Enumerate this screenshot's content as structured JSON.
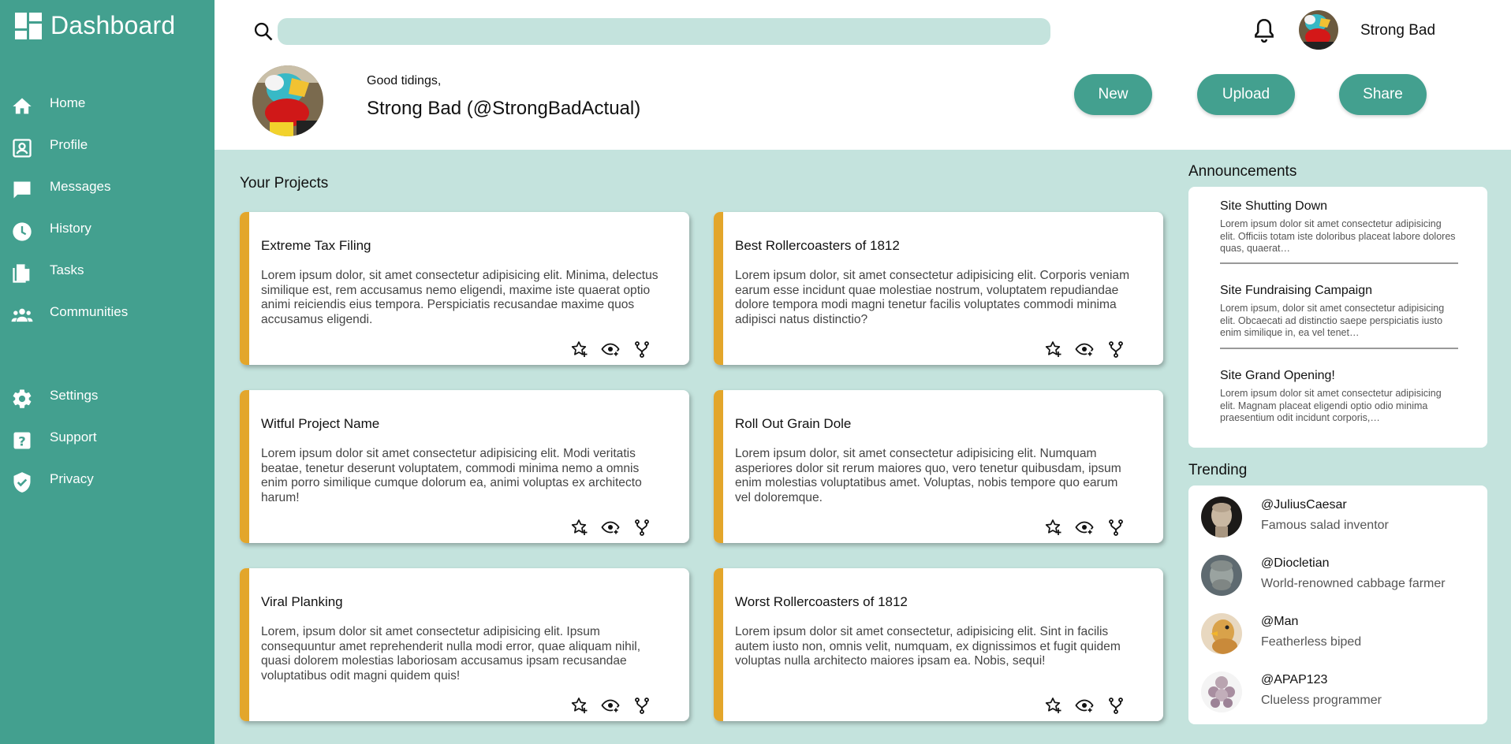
{
  "sidebar": {
    "title": "Dashboard",
    "nav": [
      {
        "label": "Home",
        "icon": "home-icon"
      },
      {
        "label": "Profile",
        "icon": "profile-card-icon"
      },
      {
        "label": "Messages",
        "icon": "chat-bubble-icon"
      },
      {
        "label": "History",
        "icon": "clock-icon"
      },
      {
        "label": "Tasks",
        "icon": "documents-icon"
      },
      {
        "label": "Communities",
        "icon": "people-icon"
      },
      {
        "label": "Settings",
        "icon": "gear-icon"
      },
      {
        "label": "Support",
        "icon": "help-icon"
      },
      {
        "label": "Privacy",
        "icon": "shield-check-icon"
      }
    ]
  },
  "header": {
    "search": {
      "value": "",
      "placeholder": ""
    },
    "username": "Strong Bad",
    "greeting": "Good tidings,",
    "handle": "Strong Bad (@StrongBadActual)",
    "buttons": {
      "new": "New",
      "upload": "Upload",
      "share": "Share"
    }
  },
  "projects": {
    "title": "Your Projects",
    "items": [
      {
        "title": "Extreme Tax Filing",
        "body": "Lorem ipsum dolor, sit amet consectetur adipisicing elit. Minima, delectus similique est, rem accusamus nemo eligendi, maxime iste quaerat optio animi reiciendis eius tempora. Perspiciatis recusandae maxime quos accusamus eligendi."
      },
      {
        "title": "Best Rollercoasters of 1812",
        "body": "Lorem ipsum dolor, sit amet consectetur adipisicing elit. Corporis veniam earum esse incidunt quae molestiae nostrum, voluptatem repudiandae dolore tempora modi magni tenetur facilis voluptates commodi minima adipisci natus distinctio?"
      },
      {
        "title": "Witful Project Name",
        "body": "Lorem ipsum dolor sit amet consectetur adipisicing elit. Modi veritatis beatae, tenetur deserunt voluptatem, commodi minima nemo a omnis enim porro similique cumque dolorum ea, animi voluptas ex architecto harum!"
      },
      {
        "title": "Roll Out Grain Dole",
        "body": "Lorem ipsum dolor, sit amet consectetur adipisicing elit. Numquam asperiores dolor sit rerum maiores quo, vero tenetur quibusdam, ipsum enim molestias voluptatibus amet. Voluptas, nobis tempore quo earum vel doloremque."
      },
      {
        "title": "Viral Planking",
        "body": "Lorem, ipsum dolor sit amet consectetur adipisicing elit. Ipsum consequuntur amet reprehenderit nulla modi error, quae aliquam nihil, quasi dolorem molestias laboriosam accusamus ipsam recusandae voluptatibus odit magni quidem quis!"
      },
      {
        "title": "Worst Rollercoasters of 1812",
        "body": "Lorem ipsum dolor sit amet consectetur, adipisicing elit. Sint in facilis autem iusto non, omnis velit, numquam, ex dignissimos et fugit quidem voluptas nulla architecto maiores ipsam ea. Nobis, sequi!"
      }
    ],
    "action_icons": [
      "star-add-icon",
      "eye-add-icon",
      "fork-icon"
    ]
  },
  "announcements": {
    "title": "Announcements",
    "items": [
      {
        "title": "Site Shutting Down",
        "text": "Lorem ipsum dolor sit amet consectetur adipisicing elit. Officiis totam iste doloribus placeat labore dolores quas, quaerat…"
      },
      {
        "title": "Site Fundraising Campaign",
        "text": "Lorem ipsum, dolor sit amet consectetur adipisicing elit. Obcaecati ad distinctio saepe perspiciatis iusto enim similique in, ea vel tenet…"
      },
      {
        "title": "Site Grand Opening!",
        "text": "Lorem ipsum dolor sit amet consectetur adipisicing elit. Magnam placeat eligendi optio odio minima praesentium odit incidunt corporis,…"
      }
    ]
  },
  "trending": {
    "title": "Trending",
    "items": [
      {
        "handle": "@JuliusCaesar",
        "desc": "Famous salad inventor"
      },
      {
        "handle": "@Diocletian",
        "desc": "World-renowned cabbage farmer"
      },
      {
        "handle": "@Man",
        "desc": "Featherless biped"
      },
      {
        "handle": "@APAP123",
        "desc": "Clueless programmer"
      }
    ]
  },
  "colors": {
    "sidebar": "#43a08f",
    "background": "#c4e3dd",
    "accent": "#e3a62b",
    "button": "#43a08f"
  }
}
